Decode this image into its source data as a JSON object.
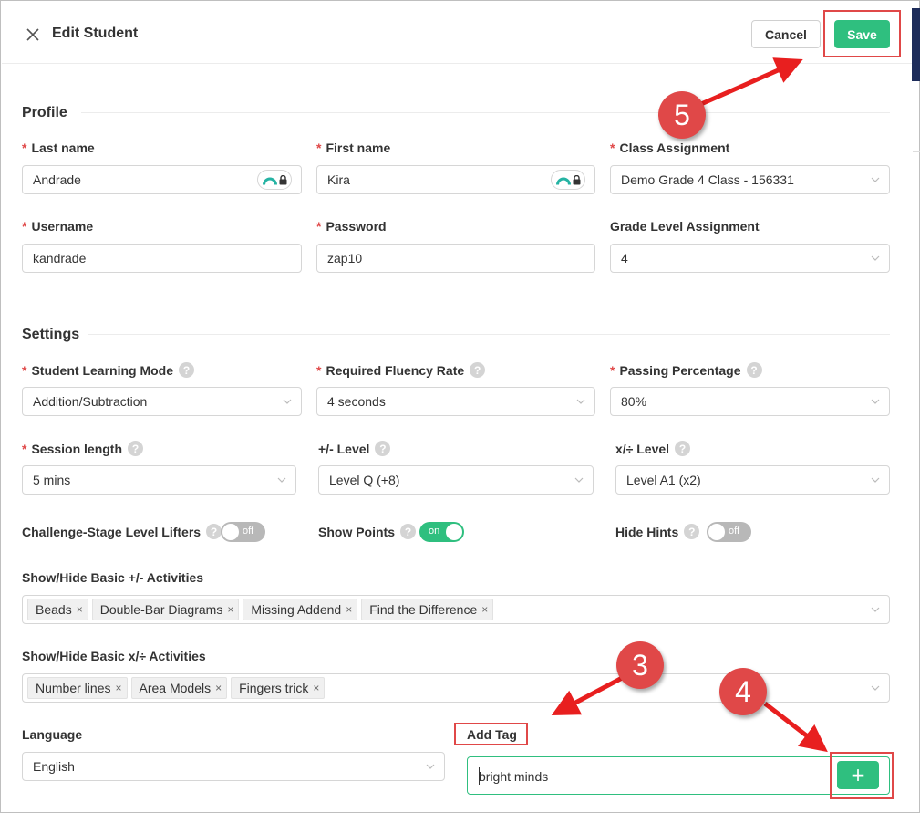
{
  "header": {
    "title": "Edit Student",
    "cancel_label": "Cancel",
    "save_label": "Save"
  },
  "profile": {
    "section_title": "Profile",
    "last_name": {
      "label": "Last name",
      "value": "Andrade"
    },
    "first_name": {
      "label": "First name",
      "value": "Kira"
    },
    "class_assignment": {
      "label": "Class Assignment",
      "value": "Demo Grade 4 Class - 156331"
    },
    "username": {
      "label": "Username",
      "value": "kandrade"
    },
    "password": {
      "label": "Password",
      "value": "zap10"
    },
    "grade_level": {
      "label": "Grade Level Assignment",
      "value": "4"
    }
  },
  "settings": {
    "section_title": "Settings",
    "learning_mode": {
      "label": "Student Learning Mode",
      "value": "Addition/Subtraction"
    },
    "fluency_rate": {
      "label": "Required Fluency Rate",
      "value": "4 seconds"
    },
    "passing_pct": {
      "label": "Passing Percentage",
      "value": "80%"
    },
    "session_length": {
      "label": "Session length",
      "value": "5 mins"
    },
    "addsub_level": {
      "label": "+/- Level",
      "value": "Level Q (+8)"
    },
    "muldiv_level": {
      "label": "x/÷ Level",
      "value": "Level A1 (x2)"
    },
    "level_lifters": {
      "label": "Challenge-Stage Level Lifters",
      "state": "off"
    },
    "show_points": {
      "label": "Show Points",
      "state": "on"
    },
    "hide_hints": {
      "label": "Hide Hints",
      "state": "off"
    },
    "addsub_activities": {
      "label": "Show/Hide Basic +/- Activities",
      "tags": [
        "Beads",
        "Double-Bar Diagrams",
        "Missing Addend",
        "Find the Difference"
      ]
    },
    "muldiv_activities": {
      "label": "Show/Hide Basic x/÷ Activities",
      "tags": [
        "Number lines",
        "Area Models",
        "Fingers trick"
      ]
    },
    "language": {
      "label": "Language",
      "value": "English"
    },
    "add_tag": {
      "label": "Add Tag",
      "value": "bright minds",
      "button": "+"
    }
  },
  "help_glyph": "?",
  "tag_remove_glyph": "×",
  "callouts": [
    "5",
    "3",
    "4"
  ],
  "colors": {
    "accent": "#2fbf7f",
    "annotation": "#e04848",
    "required": "#e04848"
  }
}
